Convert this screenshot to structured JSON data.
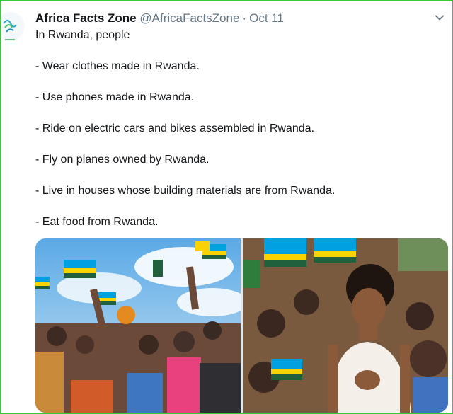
{
  "colors": {
    "frame_border": "#38c838",
    "name_text": "#14171a",
    "meta_text": "#657786",
    "rwanda_blue": "#00a1de",
    "rwanda_yellow": "#fad201",
    "rwanda_green": "#20603d"
  },
  "tweet": {
    "author_name": "Africa Facts Zone",
    "handle": "@AfricaFactsZone",
    "separator": "·",
    "date": "Oct 11",
    "menu_icon": "chevron-down-icon",
    "lines": [
      "In Rwanda, people",
      "",
      "- Wear clothes made in Rwanda.",
      "",
      "- Use phones made in Rwanda.",
      "",
      "- Ride on electric cars and bikes assembled in Rwanda.",
      "",
      "- Fly on planes owned by Rwanda.",
      "",
      "- Live in houses whose building materials are from Rwanda.",
      "",
      "- Eat food from Rwanda."
    ],
    "media": [
      {
        "description": "crowd-waving-rwanda-flags"
      },
      {
        "description": "woman-clapping-among-children-with-flags"
      }
    ]
  }
}
